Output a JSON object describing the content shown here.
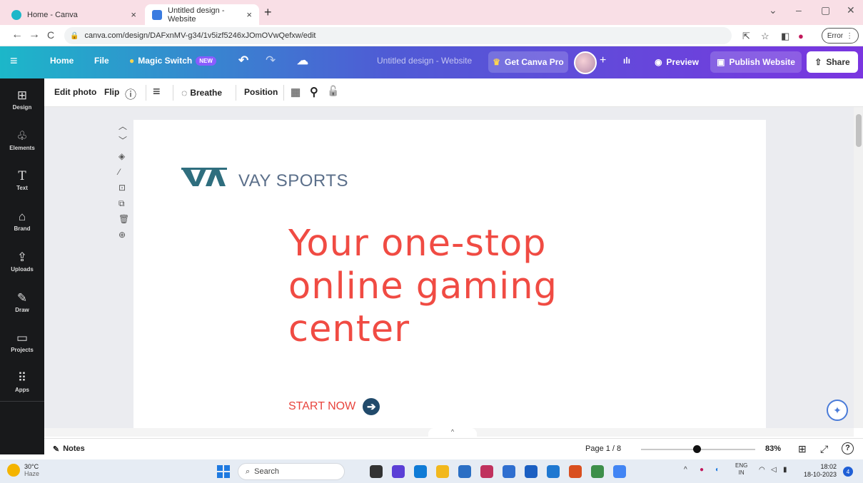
{
  "browser": {
    "tabs": [
      {
        "title": "Home - Canva",
        "close": "×",
        "active": false
      },
      {
        "title": "Untitled design - Website",
        "close": "×",
        "active": true
      }
    ],
    "new_tab": "+",
    "window_controls": {
      "menu": "⌄",
      "minimize": "–",
      "restore": "▢",
      "close": "✕"
    },
    "url": "canva.com/design/DAFxnMV-g34/1v5izf5246xJOmOVwQefxw/edit",
    "profile_error_label": "Error"
  },
  "topbar": {
    "menu_icon": "≡",
    "home_label": "Home",
    "file_label": "File",
    "magic_switch_label": "Magic Switch",
    "new_badge": "NEW",
    "undo": "↶",
    "redo": "↷",
    "cloud": "☁",
    "design_title": "Untitled design - Website",
    "get_pro_label": "Get Canva Pro",
    "add_people": "+",
    "insights_icon": "ılı",
    "preview_label": "Preview",
    "publish_label": "Publish Website",
    "share_label": "Share"
  },
  "sidebar": {
    "items": [
      {
        "label": "Design",
        "icon": "⊞"
      },
      {
        "label": "Elements",
        "icon": "♧"
      },
      {
        "label": "Text",
        "icon": "T"
      },
      {
        "label": "Brand",
        "icon": "⌂"
      },
      {
        "label": "Uploads",
        "icon": "⇪"
      },
      {
        "label": "Draw",
        "icon": "✎"
      },
      {
        "label": "Projects",
        "icon": "▭"
      },
      {
        "label": "Apps",
        "icon": "⠿"
      }
    ]
  },
  "context_toolbar": {
    "edit_photo": "Edit photo",
    "flip": "Flip",
    "info": "ⓘ",
    "lines": "≡",
    "breathe": "Breathe",
    "position": "Position",
    "transparency": "▦",
    "paint": "⚲",
    "lock": "🔓"
  },
  "canvas": {
    "side_tools": [
      "︿",
      "﹀",
      "◈",
      "⁄",
      "⊡",
      "⧉",
      "🗑",
      "⊕"
    ],
    "brand_name": "VAY SPORTS",
    "headline": [
      "Your one-stop",
      "online gaming",
      "center"
    ],
    "cta_label": "START NOW",
    "cta_arrow": "➔",
    "magic_icon": "✦",
    "collapse": "^"
  },
  "bottom_bar": {
    "notes_label": "Notes",
    "page_indicator": "Page 1 / 8",
    "zoom": "83%",
    "grid_icon": "⊞",
    "expand_icon": "⤢",
    "help_icon": "?",
    "zoom_level_fraction": 0.49
  },
  "taskbar": {
    "temperature": "30°C",
    "condition": "Haze",
    "search_label": "Search",
    "language": "ENG",
    "region": "IN",
    "time": "18:02",
    "date": "18-10-2023",
    "notifications": "4",
    "apps": [
      "#333333",
      "#5b3fd6",
      "#0f7bd6",
      "#f2b81d",
      "#2b6fc4",
      "#c0325e",
      "#2f6fd0",
      "#1b5fc2",
      "#1f78d1",
      "#d94f1f",
      "#3d8f4a",
      "#4285f4"
    ]
  },
  "colors": {
    "headline": "#f04b43",
    "brand_text": "#5b6f8a",
    "cta_arrow_bg": "#214a6b",
    "sidebar_bg": "#18191b"
  }
}
